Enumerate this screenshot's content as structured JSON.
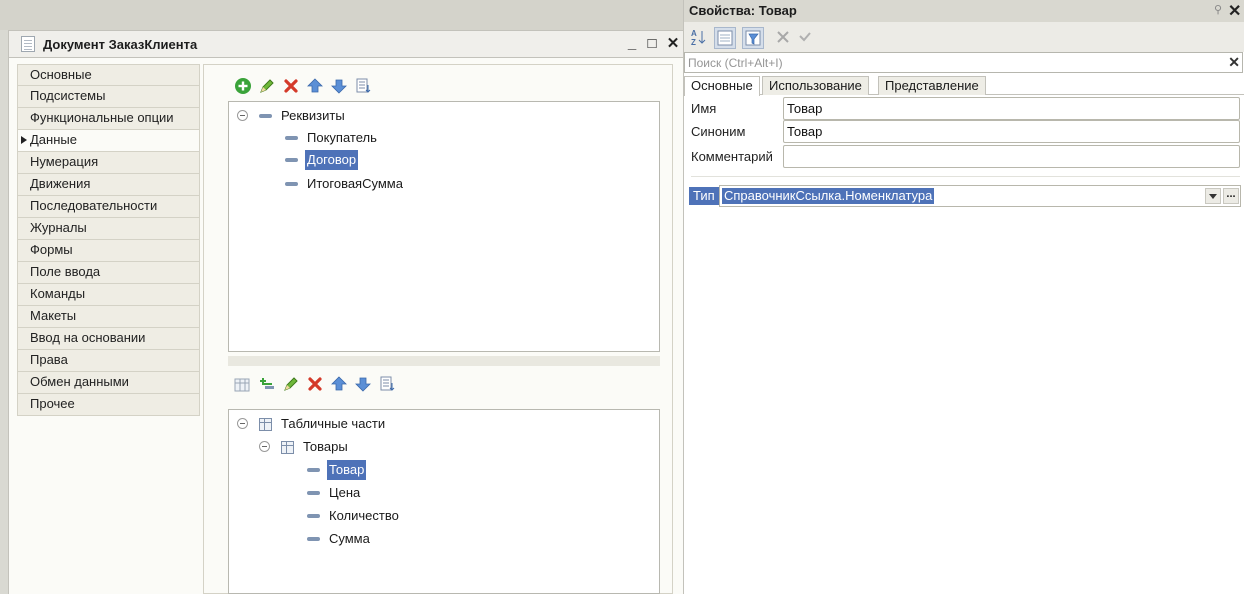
{
  "doc_window": {
    "title": "Документ ЗаказКлиента",
    "minimize": "_",
    "maximize": "□",
    "close": "✕"
  },
  "sections": [
    {
      "label": "Основные"
    },
    {
      "label": "Подсистемы"
    },
    {
      "label": "Функциональные опции"
    },
    {
      "label": "Данные",
      "active": true
    },
    {
      "label": "Нумерация"
    },
    {
      "label": "Движения"
    },
    {
      "label": "Последовательности"
    },
    {
      "label": "Журналы"
    },
    {
      "label": "Формы"
    },
    {
      "label": "Поле ввода"
    },
    {
      "label": "Команды"
    },
    {
      "label": "Макеты"
    },
    {
      "label": "Ввод на основании"
    },
    {
      "label": "Права"
    },
    {
      "label": "Обмен данными"
    },
    {
      "label": "Прочее"
    }
  ],
  "attributes_tree": {
    "root": "Реквизиты",
    "items": [
      "Покупатель",
      "Договор",
      "ИтоговаяСумма"
    ],
    "selected": "Договор"
  },
  "tabular_tree": {
    "root": "Табличные части",
    "table": "Товары",
    "items": [
      "Товар",
      "Цена",
      "Количество",
      "Сумма"
    ],
    "selected": "Товар"
  },
  "properties": {
    "title": "Свойства: Товар",
    "pin": "⚲",
    "close": "✕",
    "search_placeholder": "Поиск (Ctrl+Alt+I)",
    "search_clear": "✕",
    "tabs": [
      "Основные",
      "Использование",
      "Представление"
    ],
    "name_label": "Имя",
    "name_value": "Товар",
    "synonym_label": "Синоним",
    "synonym_value": "Товар",
    "comment_label": "Комментарий",
    "comment_value": "",
    "type_label": "Тип",
    "type_value": "СправочникСсылка.Номенклатура",
    "type_select": "..."
  },
  "colors": {
    "selection": "#4e72b8",
    "add_green": "#3aa33a",
    "delete_red": "#d43a2a",
    "arrow_blue": "#5b8fd6"
  }
}
